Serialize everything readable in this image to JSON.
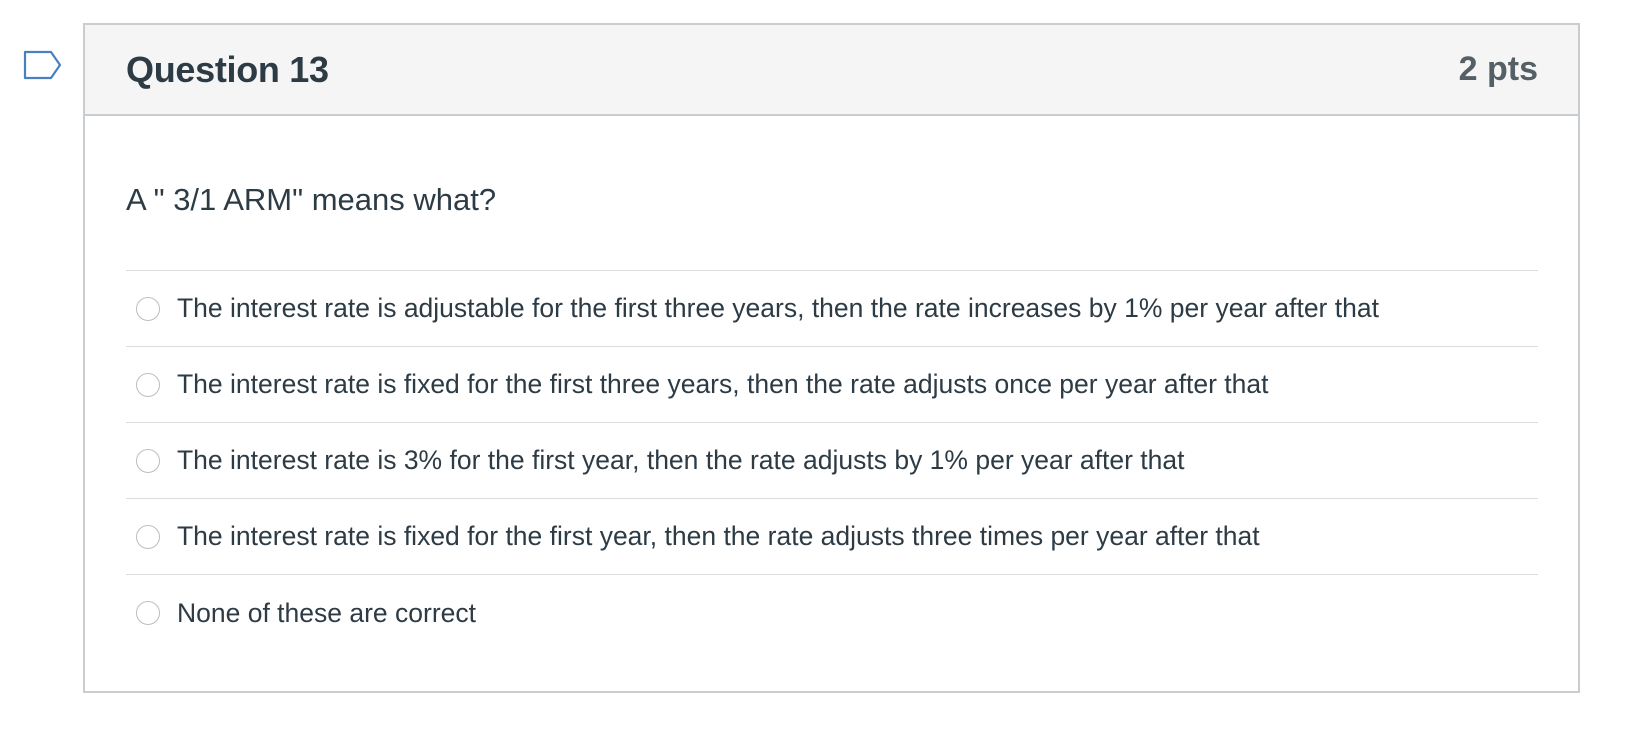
{
  "question": {
    "title": "Question 13",
    "points": "2 pts",
    "text": "A \" 3/1 ARM\" means what?",
    "flag_icon": "bookmark-flag-icon",
    "answers": [
      {
        "label": "The interest rate is adjustable for the first three years, then the rate increases by 1% per year after that",
        "selected": false
      },
      {
        "label": "The interest rate is fixed for the first three years, then the rate adjusts once per year after that",
        "selected": false
      },
      {
        "label": "The interest rate is 3% for the first year, then the rate adjusts by 1% per year after that",
        "selected": false
      },
      {
        "label": "The interest rate is fixed for the first year, then the rate adjusts three times per year after that",
        "selected": false
      },
      {
        "label": "None of these are correct",
        "selected": false
      }
    ]
  },
  "colors": {
    "flag_outline": "#4a7fc1",
    "header_background": "#f5f5f5",
    "border": "#c7cdd1",
    "text": "#2d3b45",
    "points_text": "#555f66"
  }
}
